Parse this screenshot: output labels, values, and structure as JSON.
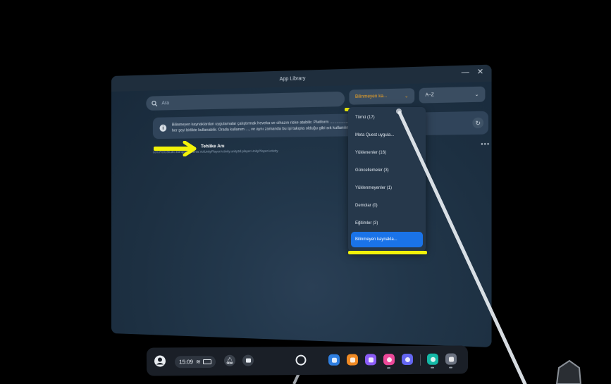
{
  "window": {
    "title": "App Library",
    "minimize_glyph": "—",
    "close_glyph": "✕"
  },
  "search": {
    "placeholder": "Ara"
  },
  "filter_dropdown": {
    "selected": "Bilinmeyen ka..."
  },
  "sort_dropdown": {
    "selected": "A–Z"
  },
  "info_banner": {
    "text": "Bilinmeyen kaynaklardan uygulamalar çalıştırmak heveka ve cihazın riske atabilir. Platform ....................... , aksesuarı ve modüllerimize ve her şeyi birlikte kullanabilir. Orada kullanım ..., ve aynı zamanda bu işi takıpta olduğu gibi sık kullanılır."
  },
  "app_list": [
    {
      "name": "Tehlike Anı",
      "package": "com.ROGStudio.Dangermoments.VolUnityPlayerActivity.unity3d.player.UnityPlayerActivity"
    }
  ],
  "filter_menu": {
    "items": [
      {
        "label": "Tümü (17)",
        "selected": false
      },
      {
        "label": "Meta Quest uygula...",
        "selected": false
      },
      {
        "label": "Yüklenenler (16)",
        "selected": false
      },
      {
        "label": "Güncellemeler (3)",
        "selected": false
      },
      {
        "label": "Yüklenmeyenler (1)",
        "selected": false
      },
      {
        "label": "Demolar (0)",
        "selected": false
      },
      {
        "label": "Eğitimler (3)",
        "selected": false
      },
      {
        "label": "Bilinmeyen kaynakla...",
        "selected": true
      }
    ]
  },
  "taskbar": {
    "time": "15:09",
    "app_icons": [
      "store-icon",
      "shop-icon",
      "people-icon",
      "camera-icon",
      "media-icon",
      "settings-app-icon",
      "grid-icon"
    ]
  },
  "colors": {
    "highlight": "#f2f20a",
    "selected": "#1a73e8",
    "accent_orange": "#f5a623"
  }
}
